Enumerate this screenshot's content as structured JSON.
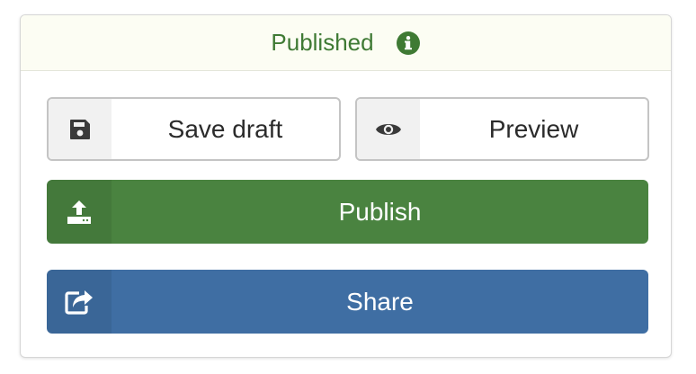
{
  "status": {
    "label": "Published",
    "color": "#3f7a34",
    "icon": "info-circle-icon"
  },
  "actions": {
    "save_draft": {
      "label": "Save draft",
      "icon": "floppy-disk-icon"
    },
    "preview": {
      "label": "Preview",
      "icon": "eye-icon"
    },
    "publish": {
      "label": "Publish",
      "icon": "upload-icon",
      "color": "#4a8340"
    },
    "share": {
      "label": "Share",
      "icon": "share-icon",
      "color": "#3f6ea3"
    }
  }
}
